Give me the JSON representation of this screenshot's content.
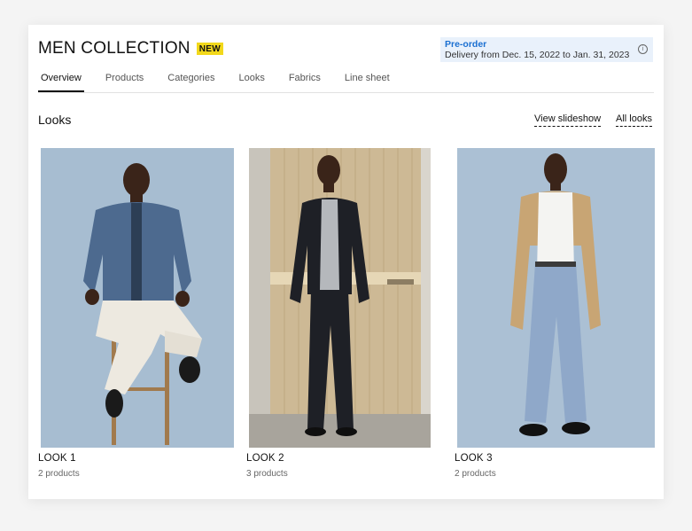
{
  "header": {
    "title": "MEN COLLECTION",
    "badge": "NEW"
  },
  "preorder": {
    "title": "Pre-order",
    "details": "Delivery from Dec. 15, 2022 to Jan. 31, 2023",
    "info_icon": "info-icon"
  },
  "tabs": [
    {
      "label": "Overview",
      "active": true
    },
    {
      "label": "Products",
      "active": false
    },
    {
      "label": "Categories",
      "active": false
    },
    {
      "label": "Looks",
      "active": false
    },
    {
      "label": "Fabrics",
      "active": false
    },
    {
      "label": "Line sheet",
      "active": false
    }
  ],
  "section": {
    "title": "Looks",
    "view_slideshow": "View slideshow",
    "all_looks": "All looks"
  },
  "looks": [
    {
      "title": "LOOK 1",
      "count": "2 products"
    },
    {
      "title": "LOOK 2",
      "count": "3 products"
    },
    {
      "title": "LOOK 3",
      "count": "2 products"
    }
  ],
  "colors": {
    "accent": "#1a6fd1",
    "badge": "#f2d81b",
    "backdrop_blue": "#a9bfd3"
  }
}
